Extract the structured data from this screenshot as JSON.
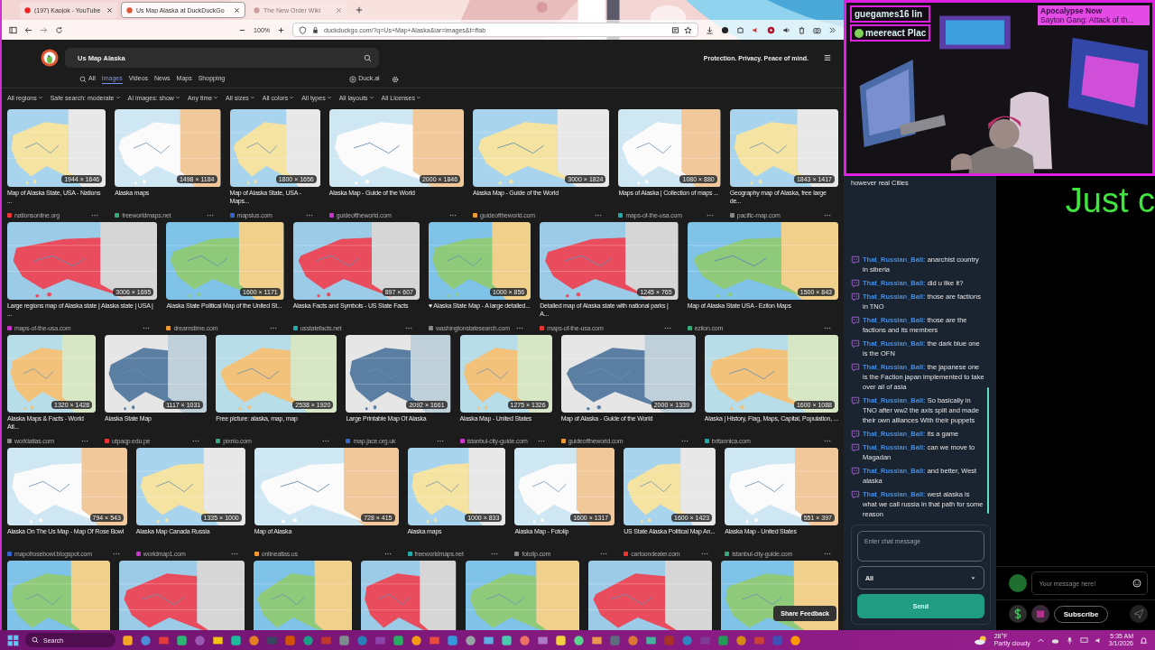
{
  "browser": {
    "tabs": [
      {
        "title": "(197) Kaojok - YouTube",
        "selected": false
      },
      {
        "title": "Us Map Alaska at DuckDuckGo",
        "selected": true
      },
      {
        "title": "The New Order Wiki",
        "selected": false
      }
    ],
    "zoom": "100%",
    "address": "duckduckgo.com/?q=Us+Map+Alaska&iar=images&t=ffab"
  },
  "search": {
    "query": "Us Map Alaska",
    "tagline": "Protection. Privacy. Peace of mind.",
    "nav": [
      {
        "label": "All",
        "selected": false
      },
      {
        "label": "Images",
        "selected": true
      },
      {
        "label": "Videos",
        "selected": false
      },
      {
        "label": "News",
        "selected": false
      },
      {
        "label": "Maps",
        "selected": false
      },
      {
        "label": "Shopping",
        "selected": false
      }
    ],
    "duck_ai": "Duck.ai",
    "filters": [
      "All regions",
      "Safe search: moderate",
      "AI images: show",
      "Any time",
      "All sizes",
      "All colors",
      "All types",
      "All layouts",
      "All Licenses"
    ]
  },
  "results": [
    {
      "items": [
        {
          "kind": "picture",
          "size": "1944 × 1646",
          "title": "Map of Alaska State, USA - Nations ...",
          "source": "nationsonline.org"
        },
        {
          "kind": "picture",
          "size": "1498 × 1184",
          "title": "Alaska maps",
          "source": "freeworldmaps.net"
        },
        {
          "kind": "picture",
          "size": "1800 × 1656",
          "title": "Map of Alaska State, USA - Maps...",
          "source": "mapsius.com"
        },
        {
          "kind": "picture",
          "size": "2000 × 1846",
          "title": "Alaska Map - Guide of the World",
          "source": "guideoftheworld.com"
        },
        {
          "kind": "picture",
          "size": "3000 × 1824",
          "title": "Alaska Map - Guide of the World",
          "source": "guideoftheworld.com"
        },
        {
          "kind": "picture",
          "size": "1080 × 880",
          "title": "Maps of Alaska | Collection of maps ...",
          "source": "maps-of-the-usa.com"
        },
        {
          "kind": "picture",
          "size": "1843 × 1417",
          "title": "Geography map of Alaska, free large de...",
          "source": "pacific-map.com"
        }
      ]
    },
    {
      "items": [
        {
          "kind": "picture",
          "size": "3006 × 1695",
          "title": "Large regions map of Alaska state | Alaska state | USA | ...",
          "source": "maps-of-the-usa.com"
        },
        {
          "kind": "picture",
          "size": "1600 × 1171",
          "title": "Alaska State Political Map of the United St...",
          "source": "dreamstime.com"
        },
        {
          "kind": "picture",
          "size": "897 × 607",
          "title": "Alaska Facts and Symbols - US State Facts",
          "source": "usstatefacts.net"
        },
        {
          "kind": "picture",
          "size": "1000 × 856",
          "title": "♥ Alaska State Map - A large detailed...",
          "source": "washingtonstatesearch.com"
        },
        {
          "kind": "picture",
          "size": "1245 × 765",
          "title": "Detailed map of Alaska state with national parks | A...",
          "source": "maps-of-the-usa.com"
        },
        {
          "kind": "picture",
          "size": "1500 × 843",
          "title": "Map of Alaska State USA - Ezilon Maps",
          "source": "ezilon.com"
        }
      ]
    },
    {
      "items": [
        {
          "kind": "picture",
          "size": "1320 × 1428",
          "title": "Alaska Maps & Facts - World Atl...",
          "source": "worldatlas.com"
        },
        {
          "kind": "picture",
          "size": "1117 × 1031",
          "title": "Alaska State Map",
          "source": "utpaqp.edu.pe"
        },
        {
          "kind": "picture",
          "size": "2538 × 1920",
          "title": "Free picture: alaska, map, map",
          "source": "pixnio.com"
        },
        {
          "kind": "picture",
          "size": "2092 × 1661",
          "title": "Large Printable Map Of Alaska",
          "source": "map.jace.org.uk"
        },
        {
          "kind": "picture",
          "size": "1275 × 1326",
          "title": "Alaska Map - United States",
          "source": "istanbul-city-guide.com"
        },
        {
          "kind": "picture",
          "size": "2000 × 1339",
          "title": "Map of Alaska - Guide of the World",
          "source": "guideoftheworld.com"
        },
        {
          "kind": "picture",
          "size": "1600 × 1088",
          "title": "Alaska | History, Flag, Maps, Capital, Population, ...",
          "source": "britannica.com"
        }
      ]
    },
    {
      "items": [
        {
          "kind": "picture",
          "size": "794 × 543",
          "title": "Alaska On The Us Map - Map Of Rose Bowl",
          "source": "mapofrosebowl.blogspot.com"
        },
        {
          "kind": "picture",
          "size": "1335 × 1000",
          "title": "Alaska Map Canada Russia",
          "source": "worldmap1.com"
        },
        {
          "kind": "picture",
          "size": "728 × 415",
          "title": "Map of Alaska",
          "source": "onlineatlas.us"
        },
        {
          "kind": "picture",
          "size": "1000 × 833",
          "title": "Alaska maps",
          "source": "freeworldmaps.net"
        },
        {
          "kind": "picture",
          "size": "1600 × 1317",
          "title": "Alaska Map - Fotolip",
          "source": "fotolip.com"
        },
        {
          "kind": "picture",
          "size": "1600 × 1423",
          "title": "US State Alaska Political Map An...",
          "source": "cartoondealer.com"
        },
        {
          "kind": "picture",
          "size": "551 × 397",
          "title": "Alaska Map - United States",
          "source": "istanbul-city-guide.com"
        }
      ]
    },
    {
      "items": [
        {
          "kind": "picture"
        },
        {
          "kind": "picture"
        },
        {
          "kind": "picture"
        },
        {
          "kind": "picture"
        },
        {
          "kind": "picture"
        },
        {
          "kind": "picture"
        },
        {
          "kind": "picture"
        }
      ]
    }
  ],
  "feedback_button": "Share Feedback",
  "stream": {
    "overlay_lines": [
      "guegames16 lin",
      "meereact Plac"
    ],
    "now_playing": {
      "title": "Apocalypse Now",
      "subtitle": "Sayton Gang: Attack of th..."
    },
    "chat": {
      "partial": "however real Cities",
      "messages": [
        {
          "user": "That_Russian_Ball:",
          "text": "anarchist country in siberia"
        },
        {
          "user": "That_Russian_Ball:",
          "text": "did u like it?"
        },
        {
          "user": "That_Russian_Ball:",
          "text": "those are factions in TNO"
        },
        {
          "user": "That_Russian_Ball:",
          "text": "those are the factions and its members"
        },
        {
          "user": "That_Russian_Ball:",
          "text": "the dark blue one is the OFN"
        },
        {
          "user": "That_Russian_Ball:",
          "text": "the japanese one is the Faction japan implemented to take over all of asia"
        },
        {
          "user": "That_Russian_Ball:",
          "text": "So basically in TNO after ww2 the axis split and made their own alliances With their puppets"
        },
        {
          "user": "That_Russian_Ball:",
          "text": "its a game"
        },
        {
          "user": "That_Russian_Ball:",
          "text": "can we move to Magadan"
        },
        {
          "user": "That_Russian_Ball:",
          "text": "and better, West alaska"
        },
        {
          "user": "That_Russian_Ball:",
          "text": "west alaska is what we call russia in that path for some reason"
        }
      ],
      "input_placeholder": "Enter chat message",
      "channel": "All",
      "send": "Send"
    },
    "side": {
      "banner": "Just c",
      "message_placeholder": "Your message here!",
      "subscribe": "Subscribe"
    }
  },
  "taskbar": {
    "search": "Search",
    "temperature": "28°F",
    "condition": "Partly cloudy",
    "time": "5:35 AM",
    "date": "3/1/2026"
  }
}
